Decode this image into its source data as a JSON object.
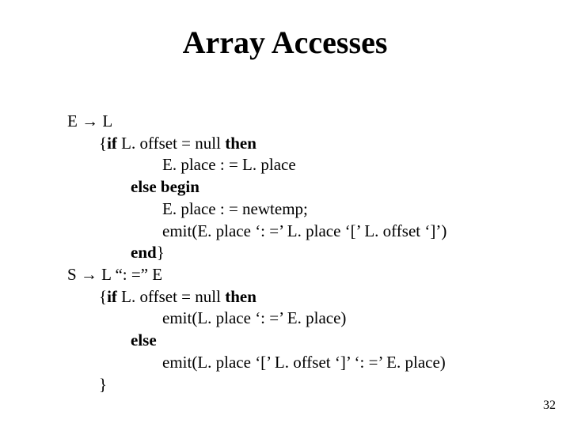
{
  "title": "Array Accesses",
  "rule1_head": "E → L",
  "line01_a": "{",
  "line01_if": "if",
  "line01_b": "  L. offset  =  null  ",
  "line01_then": "then",
  "line02": "E. place : = L. place",
  "line03_else": "else",
  "line03_begin": " begin",
  "line04": "E. place : = newtemp;",
  "line05": "emit(E. place  ‘: =’  L. place  ‘[’  L. offset  ‘]’)",
  "line06_end": "end",
  "line06_b": "}",
  "rule2_head": "S → L  “: =”  E",
  "line07_a": "{",
  "line07_if": "if",
  "line07_b": "  L. offset  =  null  ",
  "line07_then": "then",
  "line08": "emit(L. place  ‘: =’  E. place)",
  "line09_else": "else",
  "line10": "emit(L. place  ‘[’  L. offset  ‘]’  ‘: =’  E. place)",
  "line11": "}",
  "pagenum": "32"
}
